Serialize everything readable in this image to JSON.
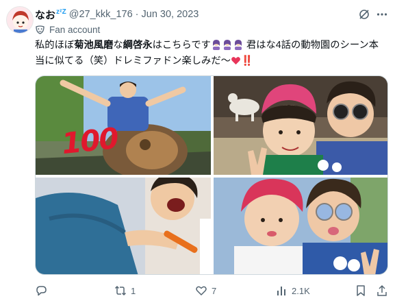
{
  "user": {
    "display_name": "なお",
    "display_name_deco": "zᶻZ",
    "handle": "@27_kkk_176",
    "dot": "·",
    "date": "Jun 30, 2023",
    "label": "Fan account"
  },
  "tweet": {
    "seg1": "私的ほぼ",
    "bold1": "菊池風磨",
    "seg2": "な",
    "bold2": "綱啓永",
    "seg3": "はこちらです",
    "seg4": "君はな4話の動物園のシーン本当に似てる（笑）ドレミファドン楽しみだ〜",
    "seg5": "‼️"
  },
  "media": {
    "tiles": [
      {
        "name": "photo-lion-statue",
        "caption_icon": "100-emoji"
      },
      {
        "name": "photo-goat-selfie",
        "caption_icon": "peace-hands"
      },
      {
        "name": "photo-carrot"
      },
      {
        "name": "photo-duo-selfie"
      }
    ],
    "sticker_100": "100"
  },
  "actions": {
    "reply_count": "",
    "retweet_count": "1",
    "like_count": "7",
    "views_count": "2.1K"
  },
  "colors": {
    "text": "#0f1419",
    "secondary": "#536471",
    "accent": "#1d9bf0",
    "border": "#cfd9de"
  },
  "icons": [
    "grok-icon",
    "more-icon",
    "mask-icon",
    "reply-icon",
    "retweet-icon",
    "like-icon",
    "views-icon",
    "bookmark-icon",
    "share-icon"
  ]
}
